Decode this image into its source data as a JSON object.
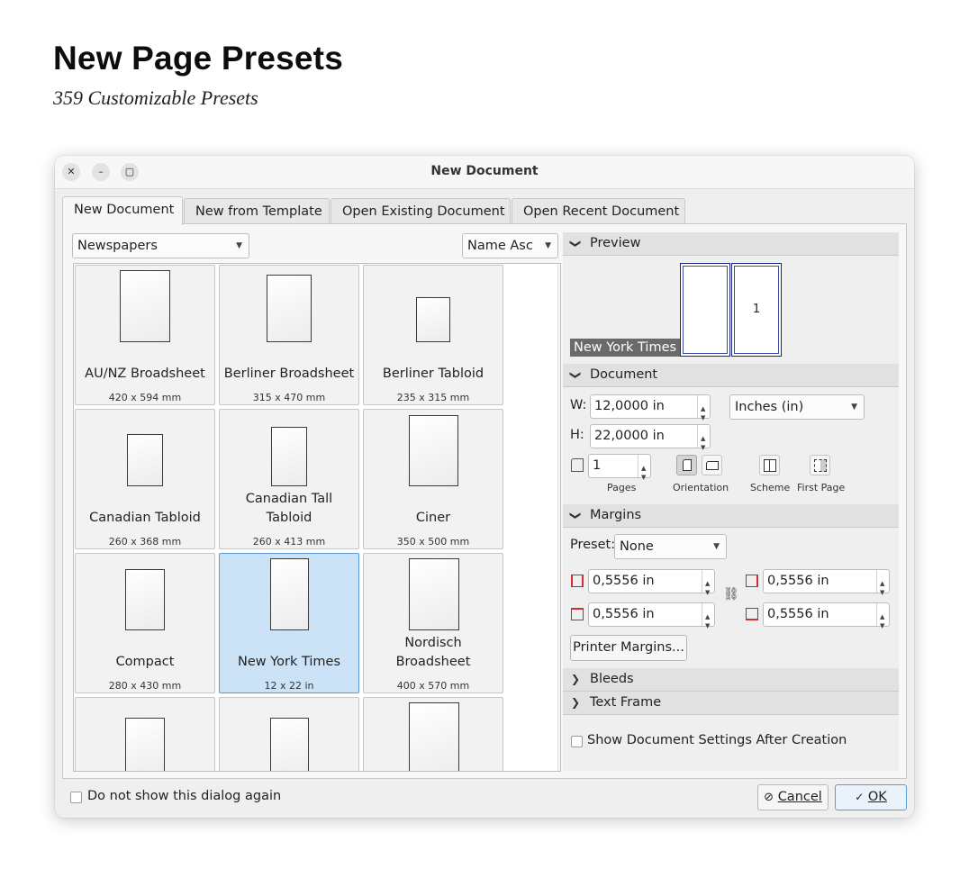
{
  "page": {
    "title": "New Page Presets",
    "subtitle": "359 Customizable Presets"
  },
  "dialog": {
    "title": "New Document",
    "window_buttons": [
      "close-icon",
      "minimize-icon",
      "maximize-icon"
    ],
    "tabs": [
      {
        "label": "New Document",
        "active": true
      },
      {
        "label": "New from Template",
        "active": false
      },
      {
        "label": "Open Existing Document",
        "active": false
      },
      {
        "label": "Open Recent Document",
        "active": false
      }
    ],
    "category": "Newspapers",
    "sort": "Name Asc",
    "presets": [
      {
        "name": "AU/NZ Broadsheet",
        "size": "420 x 594 mm"
      },
      {
        "name": "Berliner Broadsheet",
        "size": "315 x 470 mm"
      },
      {
        "name": "Berliner Tabloid",
        "size": "235 x 315 mm"
      },
      {
        "name": "Canadian Tabloid",
        "size": "260 x 368 mm"
      },
      {
        "name": "Canadian Tall Tabloid",
        "size": "260 x 413 mm"
      },
      {
        "name": "Ciner",
        "size": "350 x 500 mm"
      },
      {
        "name": "Compact",
        "size": "280 x 430 mm"
      },
      {
        "name": "New York Times",
        "size": "12 x 22 in",
        "selected": true
      },
      {
        "name": "Nordisch Broadsheet",
        "size": "400 x 570 mm"
      }
    ],
    "preview": {
      "header": "Preview",
      "caption": "New York Times",
      "page_number": "1"
    },
    "document": {
      "header": "Document",
      "width_label": "W:",
      "width_value": "12,0000 in",
      "height_label": "H:",
      "height_value": "22,0000 in",
      "units": "Inches (in)",
      "pages_value": "1",
      "pages_label": "Pages",
      "orientation_label": "Orientation",
      "scheme_label": "Scheme",
      "first_page_label": "First Page"
    },
    "margins": {
      "header": "Margins",
      "preset_label": "Preset:",
      "preset_value": "None",
      "left": "0,5556 in",
      "right": "0,5556 in",
      "top": "0,5556 in",
      "bottom": "0,5556 in",
      "printer_margins_button": "Printer Margins..."
    },
    "bleeds_header": "Bleeds",
    "text_frame_header": "Text Frame",
    "show_settings_label": "Show Document Settings After Creation",
    "dont_show_label": "Do not show this dialog again",
    "cancel_label": "Cancel",
    "ok_label": "OK",
    "accent_color": "#5a9bd6",
    "selection_color": "#cce2f7",
    "margin_marker_color": "#d03030"
  }
}
